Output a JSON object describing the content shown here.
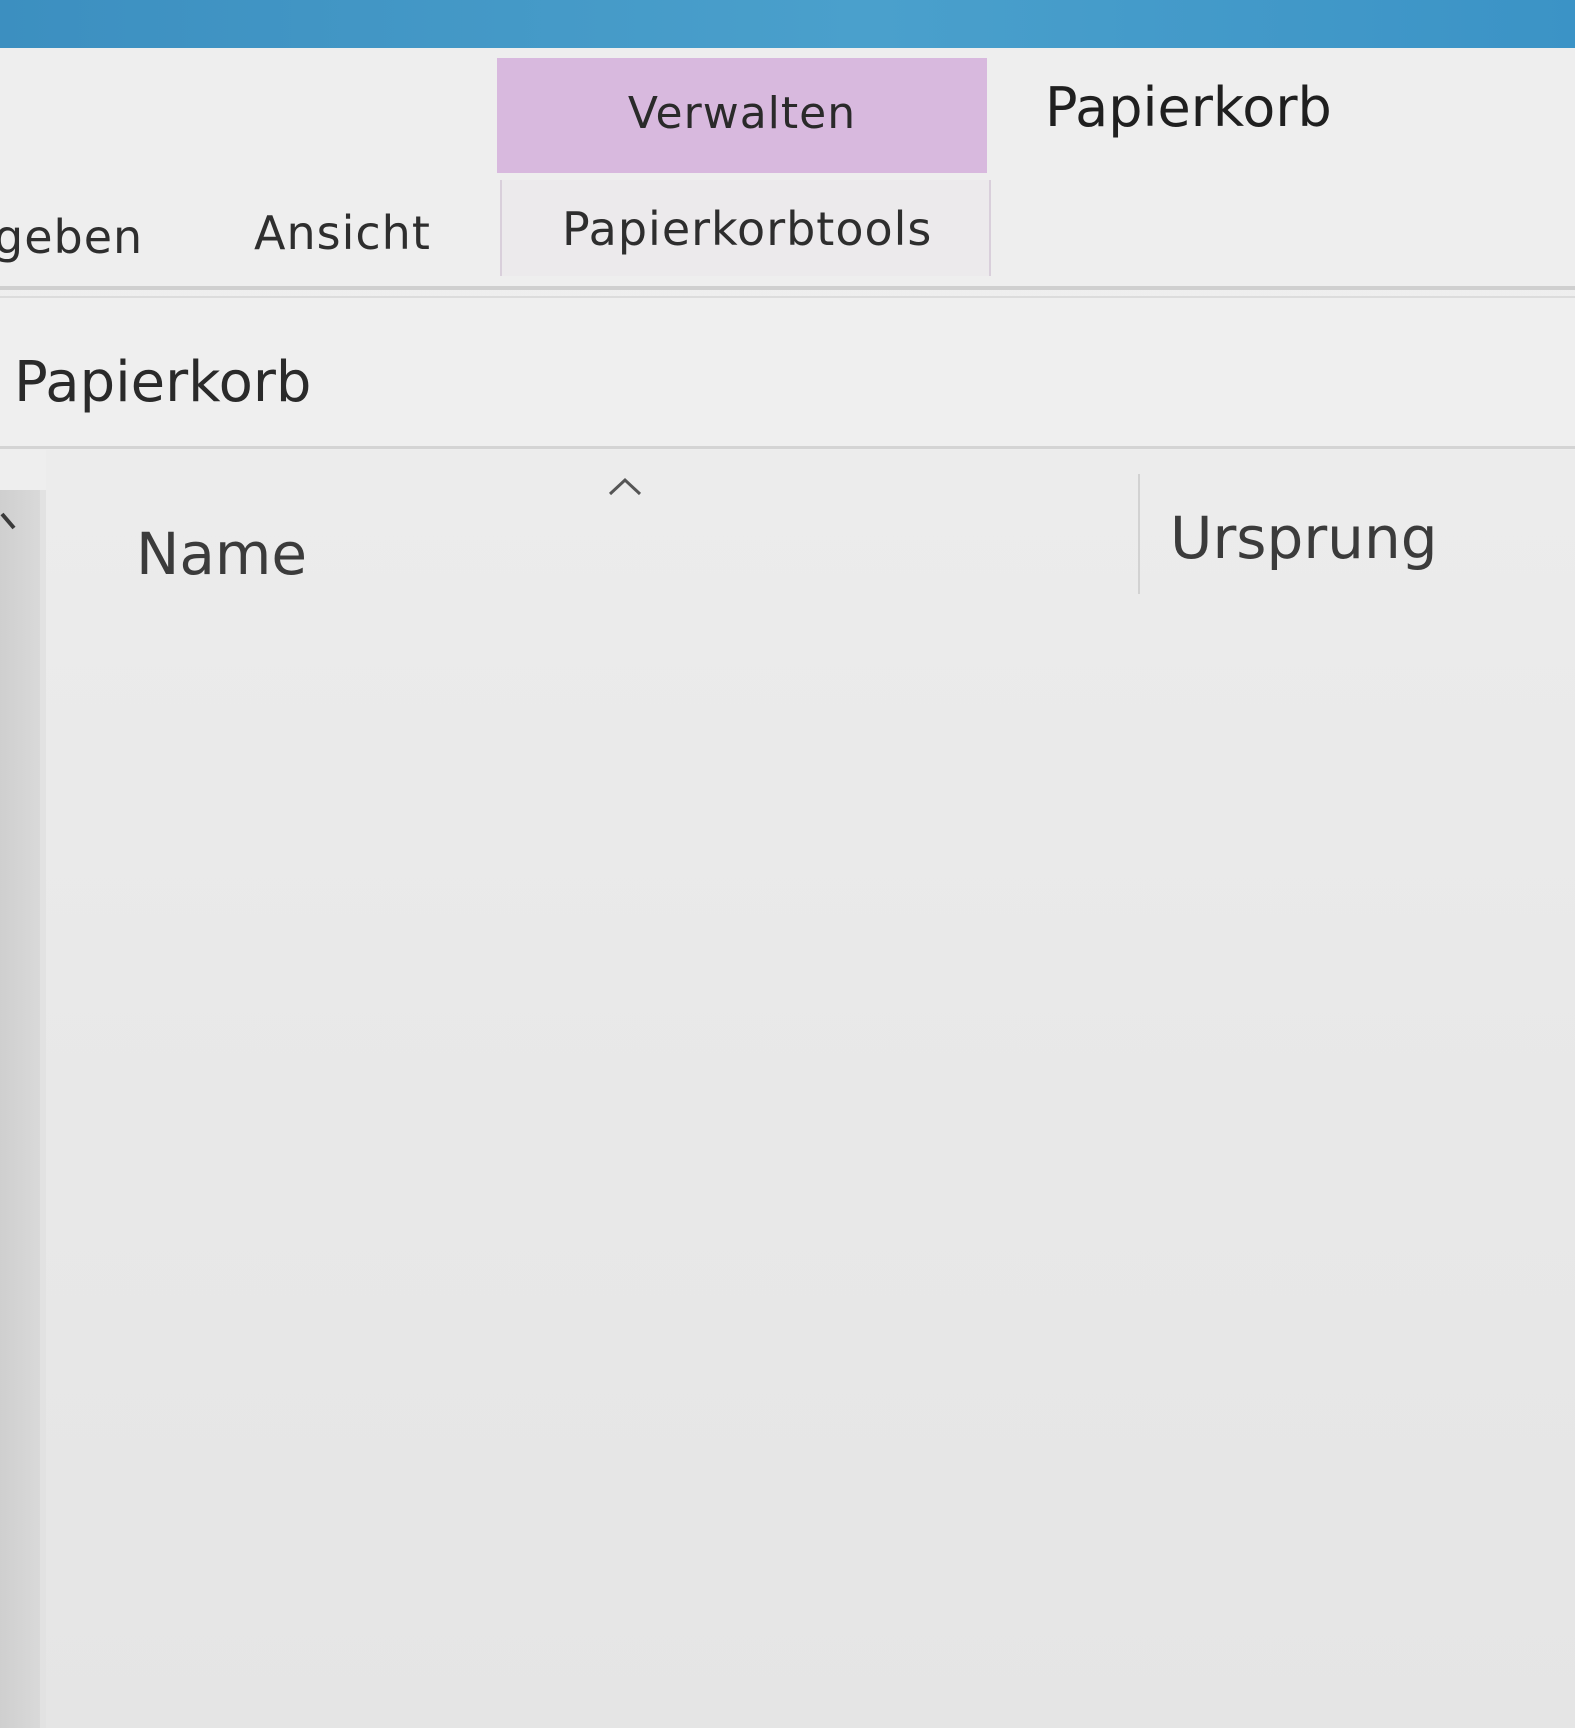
{
  "window": {
    "title": "Papierkorb"
  },
  "ribbon": {
    "context_group_label": "Verwalten",
    "tabs": [
      {
        "label": "Freigeben"
      },
      {
        "label": "Ansicht"
      },
      {
        "label": "Papierkorbtools"
      }
    ],
    "tab_visible_text": {
      "freigeben": "geben",
      "ansicht": "Ansicht",
      "tools": "Papierkorbtools"
    }
  },
  "address": {
    "location": "Papierkorb"
  },
  "file_list": {
    "columns": [
      {
        "label": "Name",
        "sorted": "ascending"
      },
      {
        "label": "Ursprung"
      }
    ],
    "items": []
  },
  "icons": {
    "sort": "sort-ascending-icon",
    "nav_expand": "chevron-icon"
  },
  "colors": {
    "title_accent": "#3c8fc0",
    "context_group": "#d8b9de"
  }
}
